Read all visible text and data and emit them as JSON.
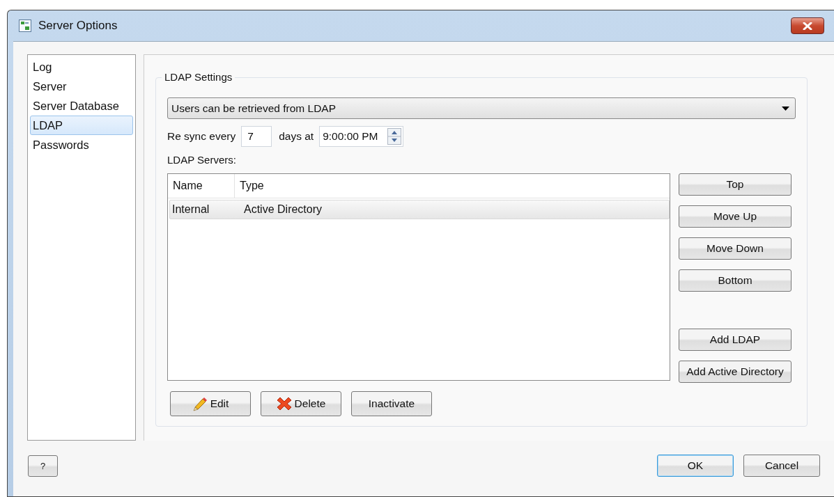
{
  "window": {
    "title": "Server Options"
  },
  "sidebar": {
    "items": [
      {
        "label": "Log",
        "selected": false
      },
      {
        "label": "Server",
        "selected": false
      },
      {
        "label": "Server Database",
        "selected": false
      },
      {
        "label": "LDAP",
        "selected": true
      },
      {
        "label": "Passwords",
        "selected": false
      }
    ]
  },
  "ldap_settings": {
    "title": "LDAP Settings",
    "mode": "Users can be retrieved from LDAP",
    "resync_label": "Re sync every",
    "days": "7",
    "days_label": "days at",
    "time": "9:00:00 PM",
    "servers_label": "LDAP Servers:",
    "table": {
      "columns": [
        "Name",
        "Type"
      ],
      "rows": [
        {
          "cells": [
            "Internal",
            "Active Directory"
          ],
          "selected": true
        }
      ]
    },
    "order_buttons": [
      "Top",
      "Move Up",
      "Move Down",
      "Bottom"
    ],
    "add_buttons": [
      "Add LDAP",
      "Add Active Directory"
    ],
    "bottom_buttons": [
      {
        "label": "Edit",
        "kind": "edit"
      },
      {
        "label": "Delete",
        "kind": "delete"
      },
      {
        "label": "Inactivate",
        "kind": "plain"
      }
    ]
  },
  "footer": {
    "help": "?",
    "buttons": [
      {
        "label": "OK",
        "default": true
      },
      {
        "label": "Cancel",
        "default": false
      }
    ]
  }
}
